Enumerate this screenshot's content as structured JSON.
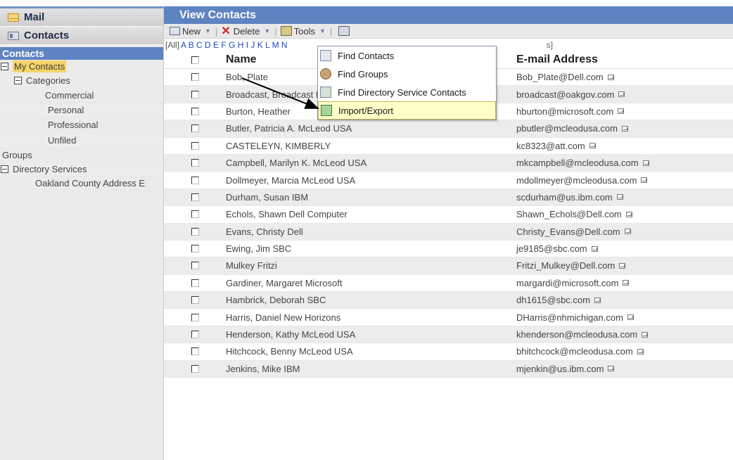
{
  "sidebar": {
    "nav": [
      {
        "label": "Mail",
        "icon": "mail-icon"
      },
      {
        "label": "Contacts",
        "icon": "contacts-icon"
      }
    ],
    "section_header": "Contacts",
    "tree": {
      "my_contacts": "My Contacts",
      "categories": "Categories",
      "category_items": [
        "Commercial",
        "Personal",
        "Professional",
        "Unfiled"
      ],
      "groups": "Groups",
      "directory_services": "Directory Services",
      "directory_item": "Oakland County Address E"
    }
  },
  "main": {
    "title": "View Contacts",
    "toolbar": {
      "new_label": "New",
      "delete_label": "Delete",
      "tools_label": "Tools"
    },
    "alpha": {
      "all": "[All]",
      "letters": "A B C D E F G H I J K L M N",
      "tail": "s]"
    },
    "columns": {
      "name": "Name",
      "email": "E-mail Address"
    },
    "rows": [
      {
        "name": "Bob, Plate",
        "email": "Bob_Plate@Dell.com"
      },
      {
        "name": "Broadcast, Broadcast Mail",
        "email": "broadcast@oakgov.com"
      },
      {
        "name": "Burton, Heather",
        "email": "hburton@microsoft.com"
      },
      {
        "name": "Butler, Patricia A. McLeod USA",
        "email": "pbutler@mcleodusa.com"
      },
      {
        "name": "CASTELEYN, KIMBERLY",
        "email": "kc8323@att.com"
      },
      {
        "name": "Campbell, Marilyn K. McLeod USA",
        "email": "mkcampbell@mcleodusa.com"
      },
      {
        "name": "Dollmeyer, Marcia McLeod USA",
        "email": "mdollmeyer@mcleodusa.com"
      },
      {
        "name": "Durham, Susan IBM",
        "email": "scdurham@us.ibm.com"
      },
      {
        "name": "Echols, Shawn Dell Computer",
        "email": "Shawn_Echols@Dell.com"
      },
      {
        "name": "Evans, Christy Dell",
        "email": "Christy_Evans@Dell.com"
      },
      {
        "name": "Ewing, Jim SBC",
        "email": "je9185@sbc.com"
      },
      {
        "name": "Mulkey Fritzi",
        "email": "Fritzi_Mulkey@Dell.com"
      },
      {
        "name": "Gardiner, Margaret Microsoft",
        "email": "margardi@microsoft.com"
      },
      {
        "name": "Hambrick, Deborah SBC",
        "email": "dh1615@sbc.com"
      },
      {
        "name": "Harris, Daniel New Horizons",
        "email": "DHarris@nhmichigan.com"
      },
      {
        "name": "Henderson, Kathy McLeod USA",
        "email": "khenderson@mcleodusa.com"
      },
      {
        "name": "Hitchcock, Benny McLeod USA",
        "email": "bhitchcock@mcleodusa.com"
      },
      {
        "name": "Jenkins, Mike IBM",
        "email": "mjenkin@us.ibm.com"
      }
    ]
  },
  "tools_menu": {
    "items": [
      {
        "label": "Find Contacts",
        "icon": "find-contacts-icon"
      },
      {
        "label": "Find Groups",
        "icon": "find-groups-icon"
      },
      {
        "label": "Find Directory Service Contacts",
        "icon": "directory-search-icon"
      },
      {
        "label": "Import/Export",
        "icon": "import-export-icon"
      }
    ]
  },
  "colors": {
    "header_blue": "#5e83c1",
    "highlight_yellow": "#f6d468",
    "menu_hover": "#ffffc8",
    "link_blue": "#1b4cc0"
  }
}
